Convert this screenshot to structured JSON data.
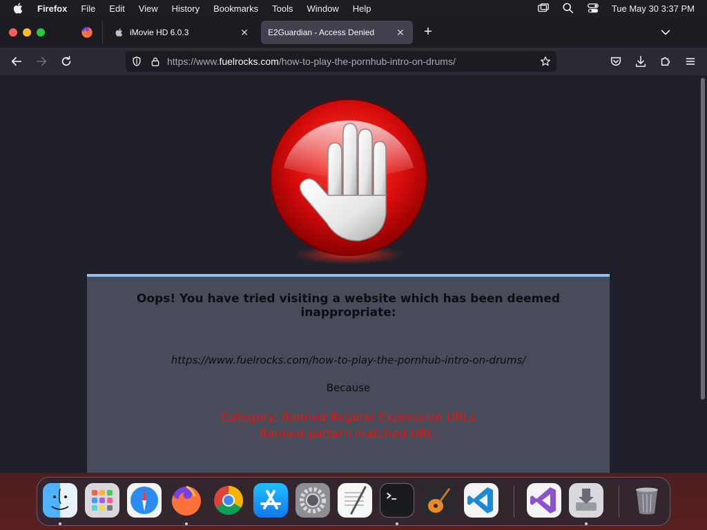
{
  "menubar": {
    "app_name": "Firefox",
    "menus": [
      "File",
      "Edit",
      "View",
      "History",
      "Bookmarks",
      "Tools",
      "Window",
      "Help"
    ],
    "clock": "Tue May 30  3:37 PM"
  },
  "tabs": [
    {
      "label": "iMovie HD 6.0.3",
      "icon": "apple-icon",
      "active": false
    },
    {
      "label": "E2Guardian - Access Denied",
      "icon": "none",
      "active": true
    }
  ],
  "urlbar": {
    "url_prefix": "https://www.",
    "url_domain": "fuelrocks.com",
    "url_path": "/how-to-play-the-pornhub-intro-on-drums/"
  },
  "page": {
    "headline": "Oops! You have tried visiting a website which has been deemed inappropriate:",
    "blocked_url": "https://www.fuelrocks.com/how-to-play-the-pornhub-intro-on-drums/",
    "because": "Because",
    "category": "Category: Banned Regular Expression URLs",
    "pattern": "Banned pattern matched URL:"
  },
  "dock": {
    "apps": [
      "finder",
      "launchpad",
      "safari",
      "firefox",
      "chrome",
      "app-store",
      "system-preferences",
      "textedit",
      "terminal",
      "garageband",
      "vscode",
      "visual-studio",
      "disk-utility",
      "trash"
    ]
  },
  "colors": {
    "accent_blue": "#8ec5f2",
    "alert_red": "#e8140e",
    "panel_bg": "#474b5a"
  }
}
